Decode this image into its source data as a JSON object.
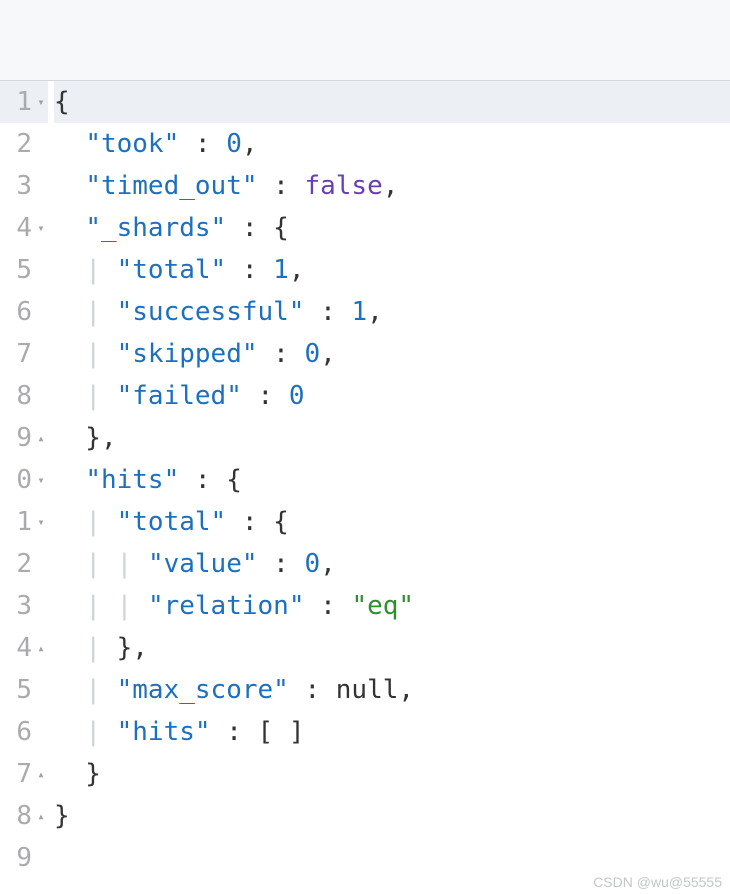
{
  "watermark": "CSDN @wu@55555",
  "json_payload": {
    "took": 0,
    "timed_out": false,
    "_shards": {
      "total": 1,
      "successful": 1,
      "skipped": 0,
      "failed": 0
    },
    "hits": {
      "total": {
        "value": 0,
        "relation": "eq"
      },
      "max_score": null,
      "hits": []
    }
  },
  "lines": [
    {
      "num": "1",
      "fold": "▾",
      "active": true,
      "tokens": [
        {
          "t": "{",
          "c": "p"
        }
      ]
    },
    {
      "num": "2",
      "fold": "",
      "active": false,
      "tokens": [
        {
          "t": "  ",
          "c": "p"
        },
        {
          "t": "\"took\"",
          "c": "k"
        },
        {
          "t": " : ",
          "c": "p"
        },
        {
          "t": "0",
          "c": "n"
        },
        {
          "t": ",",
          "c": "p"
        }
      ]
    },
    {
      "num": "3",
      "fold": "",
      "active": false,
      "tokens": [
        {
          "t": "  ",
          "c": "p"
        },
        {
          "t": "\"timed_out\"",
          "c": "k"
        },
        {
          "t": " : ",
          "c": "p"
        },
        {
          "t": "false",
          "c": "b"
        },
        {
          "t": ",",
          "c": "p"
        }
      ]
    },
    {
      "num": "4",
      "fold": "▾",
      "active": false,
      "tokens": [
        {
          "t": "  ",
          "c": "p"
        },
        {
          "t": "\"_shards\"",
          "c": "k"
        },
        {
          "t": " : {",
          "c": "p"
        }
      ]
    },
    {
      "num": "5",
      "fold": "",
      "active": false,
      "tokens": [
        {
          "t": "  ",
          "c": "p"
        },
        {
          "t": "| ",
          "c": "guide"
        },
        {
          "t": "\"total\"",
          "c": "k"
        },
        {
          "t": " : ",
          "c": "p"
        },
        {
          "t": "1",
          "c": "n"
        },
        {
          "t": ",",
          "c": "p"
        }
      ]
    },
    {
      "num": "6",
      "fold": "",
      "active": false,
      "tokens": [
        {
          "t": "  ",
          "c": "p"
        },
        {
          "t": "| ",
          "c": "guide"
        },
        {
          "t": "\"successful\"",
          "c": "k"
        },
        {
          "t": " : ",
          "c": "p"
        },
        {
          "t": "1",
          "c": "n"
        },
        {
          "t": ",",
          "c": "p"
        }
      ]
    },
    {
      "num": "7",
      "fold": "",
      "active": false,
      "tokens": [
        {
          "t": "  ",
          "c": "p"
        },
        {
          "t": "| ",
          "c": "guide"
        },
        {
          "t": "\"skipped\"",
          "c": "k"
        },
        {
          "t": " : ",
          "c": "p"
        },
        {
          "t": "0",
          "c": "n"
        },
        {
          "t": ",",
          "c": "p"
        }
      ]
    },
    {
      "num": "8",
      "fold": "",
      "active": false,
      "tokens": [
        {
          "t": "  ",
          "c": "p"
        },
        {
          "t": "| ",
          "c": "guide"
        },
        {
          "t": "\"failed\"",
          "c": "k"
        },
        {
          "t": " : ",
          "c": "p"
        },
        {
          "t": "0",
          "c": "n"
        }
      ]
    },
    {
      "num": "9",
      "fold": "▴",
      "active": false,
      "tokens": [
        {
          "t": "  },",
          "c": "p"
        }
      ]
    },
    {
      "num": "0",
      "fold": "▾",
      "active": false,
      "tokens": [
        {
          "t": "  ",
          "c": "p"
        },
        {
          "t": "\"hits\"",
          "c": "k"
        },
        {
          "t": " : {",
          "c": "p"
        }
      ]
    },
    {
      "num": "1",
      "fold": "▾",
      "active": false,
      "tokens": [
        {
          "t": "  ",
          "c": "p"
        },
        {
          "t": "| ",
          "c": "guide"
        },
        {
          "t": "\"total\"",
          "c": "k"
        },
        {
          "t": " : {",
          "c": "p"
        }
      ]
    },
    {
      "num": "2",
      "fold": "",
      "active": false,
      "tokens": [
        {
          "t": "  ",
          "c": "p"
        },
        {
          "t": "| | ",
          "c": "guide"
        },
        {
          "t": "\"value\"",
          "c": "k"
        },
        {
          "t": " : ",
          "c": "p"
        },
        {
          "t": "0",
          "c": "n"
        },
        {
          "t": ",",
          "c": "p"
        }
      ]
    },
    {
      "num": "3",
      "fold": "",
      "active": false,
      "tokens": [
        {
          "t": "  ",
          "c": "p"
        },
        {
          "t": "| | ",
          "c": "guide"
        },
        {
          "t": "\"relation\"",
          "c": "k"
        },
        {
          "t": " : ",
          "c": "p"
        },
        {
          "t": "\"eq\"",
          "c": "s"
        }
      ]
    },
    {
      "num": "4",
      "fold": "▴",
      "active": false,
      "tokens": [
        {
          "t": "  ",
          "c": "p"
        },
        {
          "t": "| ",
          "c": "guide"
        },
        {
          "t": "},",
          "c": "p"
        }
      ]
    },
    {
      "num": "5",
      "fold": "",
      "active": false,
      "tokens": [
        {
          "t": "  ",
          "c": "p"
        },
        {
          "t": "| ",
          "c": "guide"
        },
        {
          "t": "\"max_score\"",
          "c": "k"
        },
        {
          "t": " : ",
          "c": "p"
        },
        {
          "t": "null",
          "c": "nl"
        },
        {
          "t": ",",
          "c": "p"
        }
      ]
    },
    {
      "num": "6",
      "fold": "",
      "active": false,
      "tokens": [
        {
          "t": "  ",
          "c": "p"
        },
        {
          "t": "| ",
          "c": "guide"
        },
        {
          "t": "\"hits\"",
          "c": "k"
        },
        {
          "t": " : [ ]",
          "c": "p"
        }
      ]
    },
    {
      "num": "7",
      "fold": "▴",
      "active": false,
      "tokens": [
        {
          "t": "  }",
          "c": "p"
        }
      ]
    },
    {
      "num": "8",
      "fold": "▴",
      "active": false,
      "tokens": [
        {
          "t": "}",
          "c": "p"
        }
      ]
    },
    {
      "num": "9",
      "fold": "",
      "active": false,
      "tokens": [
        {
          "t": "",
          "c": "p"
        }
      ]
    }
  ]
}
